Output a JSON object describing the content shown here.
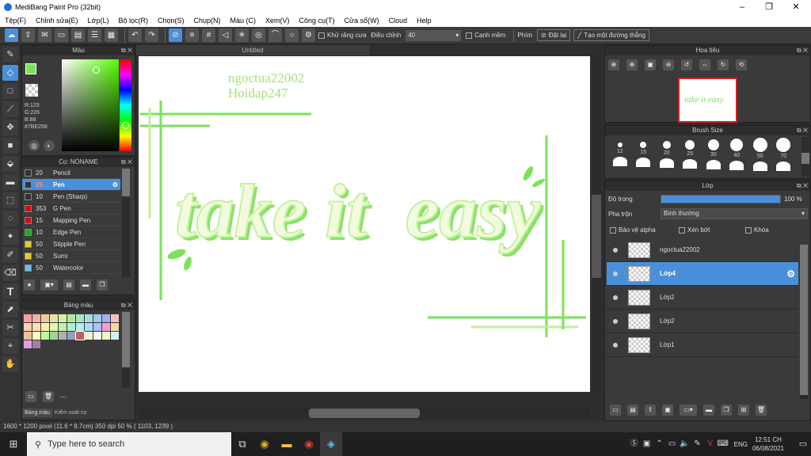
{
  "window": {
    "title": "MediBang Paint Pro (32bit)",
    "minimize": "–",
    "maximize": "❐",
    "close": "✕"
  },
  "menu": [
    "Tệp(F)",
    "Chỉnh sửa(E)",
    "Lớp(L)",
    "Bộ lọc(R)",
    "Chọn(S)",
    "Chụp(N)",
    "Màu (C)",
    "Xem(V)",
    "Công cụ(T)",
    "Cửa sổ(W)",
    "Cloud",
    "Help"
  ],
  "toolbar": {
    "antialias_label": "Khử răng cưa",
    "adjust_label": "Điều chỉnh",
    "adjust_value": "40",
    "edge_label": "Cạnh mềm",
    "key_label": "Phím",
    "reset_label": "Đặt lại",
    "straight_label": "Tạo một đường thẳng"
  },
  "color_panel": {
    "title": "Màu",
    "r": "R:123",
    "g": "G:226",
    "b": "B:88",
    "hex": "#7BE258",
    "main_color": "#7BE258"
  },
  "brush_panel": {
    "title": "Cọ: NONAME",
    "items": [
      {
        "size": "20",
        "name": "Pencil",
        "color": "#333333"
      },
      {
        "size": "25",
        "name": "Pen",
        "color": "#333333"
      },
      {
        "size": "10",
        "name": "Pen (Sharp)",
        "color": "#333333"
      },
      {
        "size": "353",
        "name": "G Pen",
        "color": "#d01010"
      },
      {
        "size": "15",
        "name": "Mapping Pen",
        "color": "#d01010"
      },
      {
        "size": "10",
        "name": "Edge Pen",
        "color": "#22aa22"
      },
      {
        "size": "50",
        "name": "Stipple Pen",
        "color": "#e0d020"
      },
      {
        "size": "50",
        "name": "Sumi",
        "color": "#e0d020"
      },
      {
        "size": "50",
        "name": "Watercolor",
        "color": "#60c0f0"
      }
    ]
  },
  "palette_panel": {
    "title": "Bảng màu",
    "footer": "---",
    "colors": [
      "#f4a0a0",
      "#f4b0a0",
      "#f0c8a0",
      "#f0e0a0",
      "#d8f0a0",
      "#b0e8a0",
      "#a0e8c0",
      "#a0e0e0",
      "#a0c8f0",
      "#a0b0f0",
      "#f8c0c0",
      "#f8d0b0",
      "#f8e0b0",
      "#f8f0b0",
      "#e0f8b0",
      "#c0f0b0",
      "#b0f0d0",
      "#b0f0f0",
      "#b0d8f8",
      "#b0c0f8",
      "#f0a0d0",
      "#f8d8a0",
      "#f0c0a0",
      "#f8f8c0",
      "#c0f8a0",
      "#a0d890",
      "#b0b0b0",
      "#90a0c0",
      "#c06060",
      "#f8f0c8",
      "#f8f8f8",
      "#f0f8c0",
      "#d0f0f8",
      "#e0a0e0",
      "#a080a0"
    ],
    "tabs": [
      "Bảng màu",
      "Kiểm soát cọ"
    ]
  },
  "canvas": {
    "tab_title": "Untitled",
    "credit_line1": "ngoctua22002",
    "credit_line2": "Hoidap247",
    "main_text": "take it  easy"
  },
  "navigator": {
    "title": "Hoa tiêu",
    "thumb_text": "take it easy"
  },
  "brush_size": {
    "title": "Brush Size",
    "sizes": [
      "12",
      "15",
      "20",
      "25",
      "30",
      "40",
      "50",
      "70"
    ]
  },
  "layer_panel": {
    "title": "Lớp",
    "opacity_label": "Độ trong",
    "opacity_value": "100 %",
    "opacity_fraction": 1.0,
    "blend_label": "Pha trộn",
    "blend_value": "Bình thường",
    "protect_alpha": "Bảo vệ alpha",
    "clipping": "Xén bớt",
    "lock": "Khóa",
    "layers": [
      {
        "name": "ngoctua22002",
        "selected": false
      },
      {
        "name": "Lớp4",
        "selected": true
      },
      {
        "name": "Lớp2",
        "selected": false
      },
      {
        "name": "Lớp2",
        "selected": false
      },
      {
        "name": "Lớp1",
        "selected": false
      }
    ]
  },
  "status": {
    "text": "1600 * 1200 pixel   (11.6 * 8.7cm)   350 dpi   50 %   ( 1103, 1239 )"
  },
  "taskbar": {
    "search_placeholder": "Type here to search",
    "time": "12:51 CH",
    "date": "06/08/2021",
    "lang": "ENG"
  }
}
